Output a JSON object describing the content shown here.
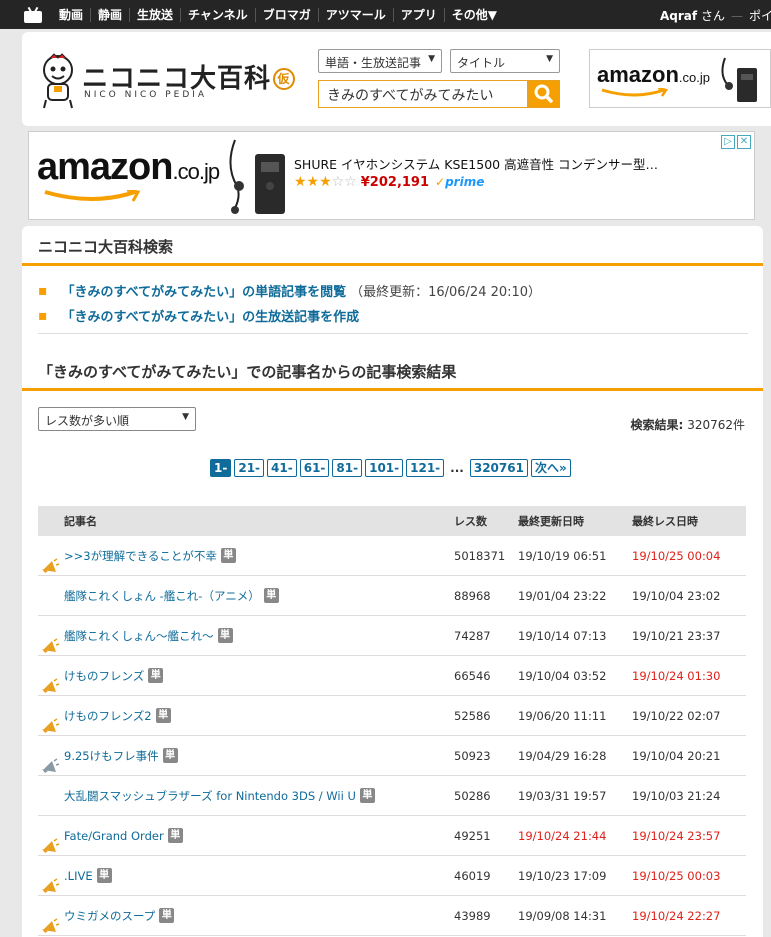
{
  "topbar": {
    "nav": [
      "動画",
      "静画",
      "生放送",
      "チャンネル",
      "ブロマガ",
      "アツマール",
      "アプリ",
      "その他▼"
    ],
    "user_name": "Aqraf",
    "user_suffix": "さん",
    "separator": "—",
    "points_label": "ポイン"
  },
  "header": {
    "logo_title": "ニコニコ大百科",
    "logo_kari": "仮",
    "logo_sub": "NICO NICO PEDIA",
    "type_select": "単語・生放送記事",
    "field_select": "タイトル",
    "search_value": "きみのすべてがみてみたい"
  },
  "ad": {
    "brand": "amazon",
    "brand_suffix": ".co.jp",
    "product": "SHURE イヤホンシステム KSE1500 高遮音性 コンデンサー型…",
    "stars": "★★★☆☆",
    "price": "¥202,191",
    "prime": "prime",
    "header_brand": "amazon",
    "header_brand_suffix": ".co.jp"
  },
  "colors": {
    "accent": "#f5a000",
    "link": "#0f6b9a",
    "red": "#e0201a",
    "topbar": "#252525"
  },
  "search_section": {
    "title": "ニコニコ大百科検索",
    "links": [
      {
        "text": "「きみのすべてがみてみたい」の単語記事を閲覧",
        "note": "（最終更新：16/06/24 20:10）"
      },
      {
        "text": "「きみのすべてがみてみたい」の生放送記事を作成",
        "note": ""
      }
    ]
  },
  "results_section": {
    "title": "「きみのすべてがみてみたい」での記事名からの記事検索結果",
    "sort": "レス数が多い順",
    "count_label": "検索結果:",
    "count_value": "320762件",
    "pages": [
      "1-",
      "21-",
      "41-",
      "61-",
      "81-",
      "101-",
      "121-",
      "...",
      "320761",
      "次へ»"
    ]
  },
  "table": {
    "headers": [
      "記事名",
      "レス数",
      "最終更新日時",
      "最終レス日時"
    ],
    "tag_label": "単",
    "rows": [
      {
        "name": ">>3が理解できることが不幸",
        "res": "5018371",
        "updated": "19/10/19 06:51",
        "last": "19/10/25 00:04",
        "upd_red": false,
        "last_red": true,
        "icon": "orange"
      },
      {
        "name": "艦隊これくしょん -艦これ-（アニメ）",
        "res": "88968",
        "updated": "19/01/04 23:22",
        "last": "19/10/04 23:02",
        "upd_red": false,
        "last_red": false,
        "icon": "none"
      },
      {
        "name": "艦隊これくしょん〜艦これ〜",
        "res": "74287",
        "updated": "19/10/14 07:13",
        "last": "19/10/21 23:37",
        "upd_red": false,
        "last_red": false,
        "icon": "orange"
      },
      {
        "name": "けものフレンズ",
        "res": "66546",
        "updated": "19/10/04 03:52",
        "last": "19/10/24 01:30",
        "upd_red": false,
        "last_red": true,
        "icon": "orange"
      },
      {
        "name": "けものフレンズ2",
        "res": "52586",
        "updated": "19/06/20 11:11",
        "last": "19/10/22 02:07",
        "upd_red": false,
        "last_red": false,
        "icon": "orange"
      },
      {
        "name": "9.25けもフレ事件",
        "res": "50923",
        "updated": "19/04/29 16:28",
        "last": "19/10/04 20:21",
        "upd_red": false,
        "last_red": false,
        "icon": "gray"
      },
      {
        "name": "大乱闘スマッシュブラザーズ for Nintendo 3DS / Wii U",
        "res": "50286",
        "updated": "19/03/31 19:57",
        "last": "19/10/03 21:24",
        "upd_red": false,
        "last_red": false,
        "icon": "none"
      },
      {
        "name": "Fate/Grand Order",
        "res": "49251",
        "updated": "19/10/24 21:44",
        "last": "19/10/24 23:57",
        "upd_red": true,
        "last_red": true,
        "icon": "orange"
      },
      {
        "name": ".LIVE",
        "res": "46019",
        "updated": "19/10/23 17:09",
        "last": "19/10/25 00:03",
        "upd_red": false,
        "last_red": true,
        "icon": "orange"
      },
      {
        "name": "ウミガメのスープ",
        "res": "43989",
        "updated": "19/09/08 14:31",
        "last": "19/10/24 22:27",
        "upd_red": false,
        "last_red": true,
        "icon": "orange"
      }
    ]
  }
}
